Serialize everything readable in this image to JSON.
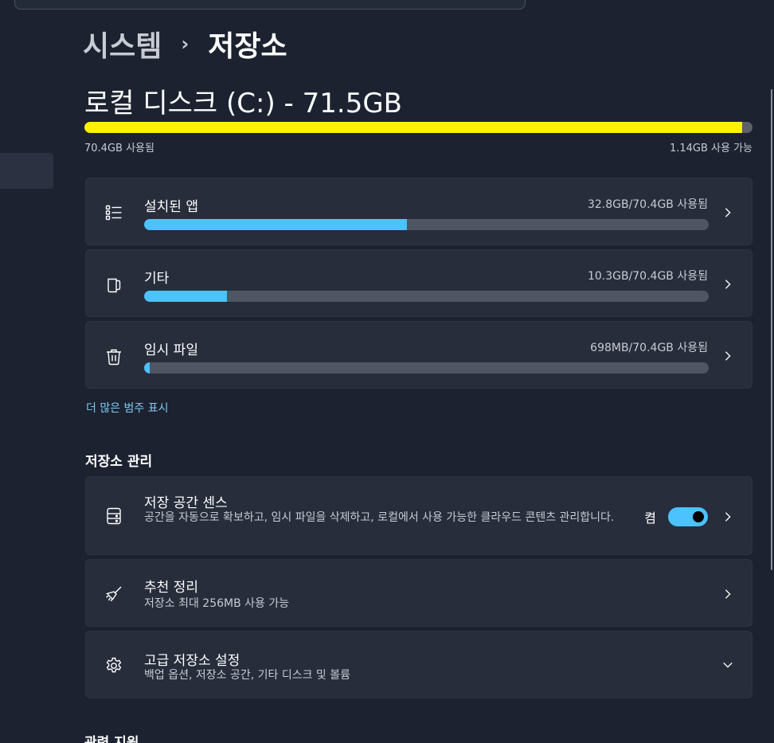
{
  "breadcrumb": {
    "parent": "시스템",
    "separator": "›",
    "current": "저장소"
  },
  "disk": {
    "title": "로컬 디스크 (C:) - 71.5GB",
    "used_fraction": 0.985,
    "used_label": "70.4GB 사용됨",
    "free_label": "1.14GB 사용 가능",
    "bar_color": "#fff200"
  },
  "categories": [
    {
      "icon": "apps-list-icon",
      "title": "설치된 앱",
      "usage": "32.8GB/70.4GB 사용됨",
      "fraction": 0.466
    },
    {
      "icon": "other-files-icon",
      "title": "기타",
      "usage": "10.3GB/70.4GB 사용됨",
      "fraction": 0.146
    },
    {
      "icon": "trash-icon",
      "title": "임시 파일",
      "usage": "698MB/70.4GB 사용됨",
      "fraction": 0.01
    }
  ],
  "accent_color": "#4cc2ff",
  "more_link": "더 많은 범주 표시",
  "manage": {
    "title": "저장소 관리",
    "storage_sense": {
      "title": "저장 공간 센스",
      "desc": "공간을 자동으로 확보하고, 임시 파일을 삭제하고, 로컬에서 사용 가능한 클라우드 콘텐츠 관리합니다.",
      "toggle_label": "켬",
      "toggle_on": true
    },
    "cleanup": {
      "title": "추천 정리",
      "desc": "저장소 최대 256MB 사용 가능"
    },
    "advanced": {
      "title": "고급 저장소 설정",
      "desc": "백업 옵션, 저장소 공간, 기타 디스크 및 볼륨"
    }
  },
  "related": {
    "title": "관련 지원"
  }
}
